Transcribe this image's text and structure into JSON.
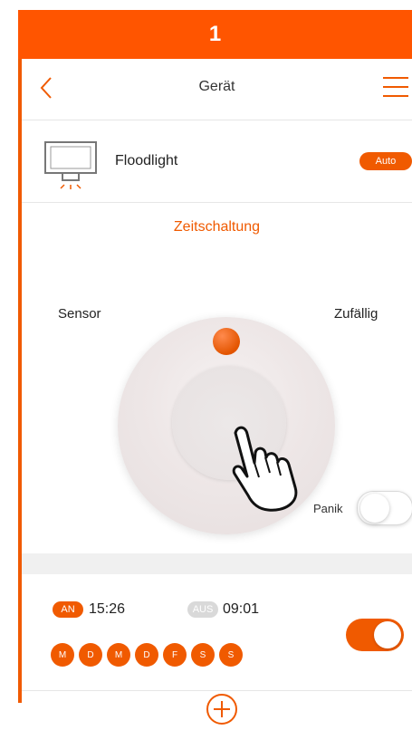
{
  "step": {
    "number": "1"
  },
  "nav": {
    "title": "Gerät"
  },
  "device": {
    "name": "Floodlight",
    "mode_badge": "Auto"
  },
  "mode": {
    "selected_label": "Zeitschaltung",
    "left_label": "Sensor",
    "right_label": "Zufällig",
    "panik_label": "Panik",
    "panik_on": false
  },
  "schedule": {
    "on_label": "AN",
    "on_time": "15:26",
    "off_label": "AUS",
    "off_time": "09:01",
    "days": [
      "M",
      "D",
      "M",
      "D",
      "F",
      "S",
      "S"
    ],
    "enabled": true
  },
  "colors": {
    "accent": "#f05a00",
    "banner": "#ff5500",
    "toggle_on": "#f05a00",
    "inactive_pill": "#d9d9d9"
  },
  "icons": {
    "back": "chevron-left-icon",
    "menu": "hamburger-menu-icon",
    "device": "floodlight-icon",
    "add": "plus-circle-icon",
    "gesture": "hand-pointer-icon"
  }
}
